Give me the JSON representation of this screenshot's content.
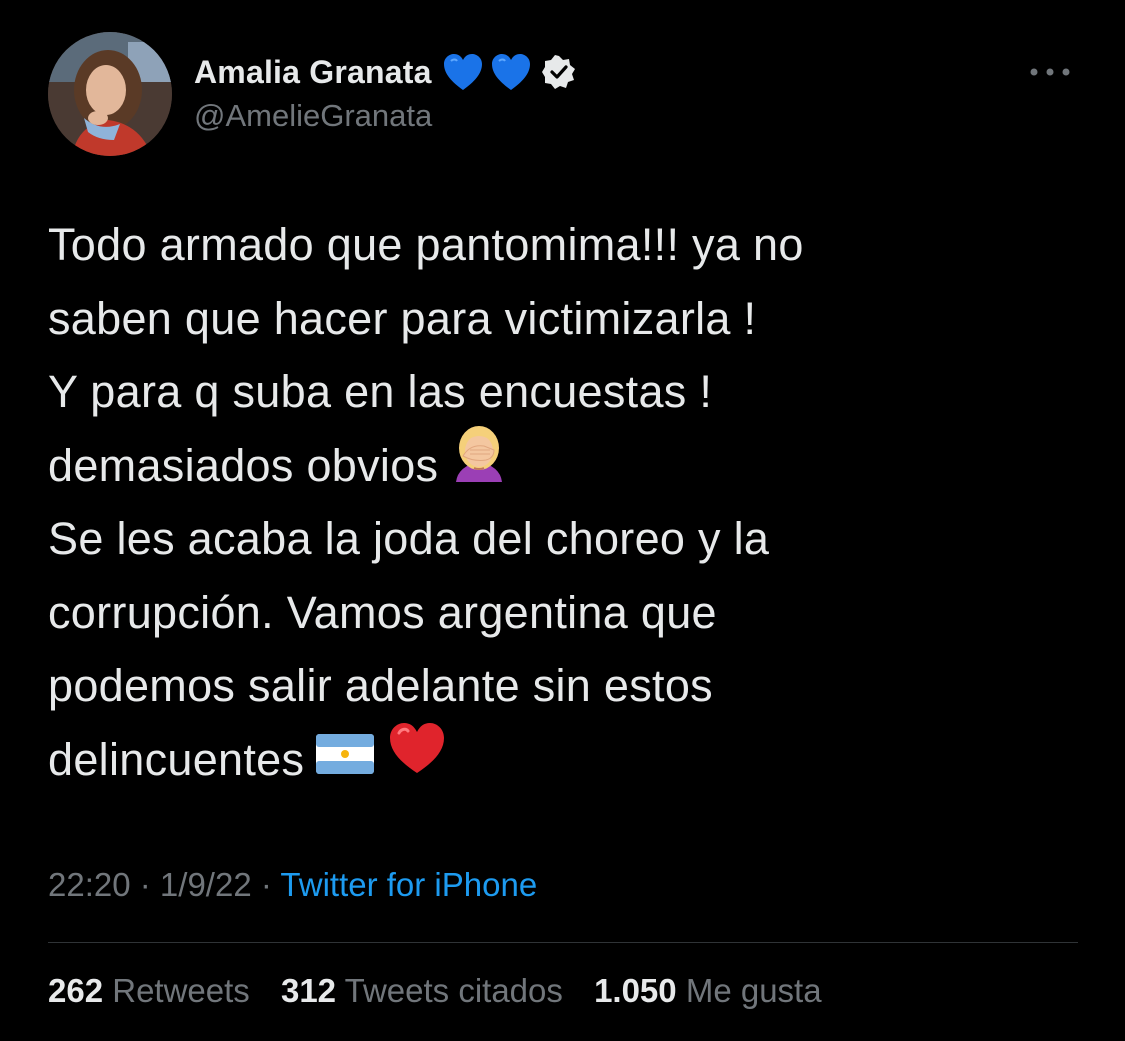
{
  "author": {
    "display_name": "Amalia Granata",
    "handle": "@AmelieGranata",
    "name_emoji": [
      "blue-heart-icon",
      "blue-heart-icon"
    ],
    "verified": true
  },
  "tweet": {
    "lines": [
      "Todo armado que pantomima!!! ya no",
      "saben que hacer para victimizarla !",
      "Y para q suba en las encuestas !",
      "demasiados obvios",
      "Se les acaba la joda del choreo y la",
      "corrupción. Vamos argentina que",
      "podemos salir adelante sin estos",
      "delincuentes"
    ],
    "emoji": {
      "line4": "face-palm-icon",
      "line8": [
        "argentina-flag-icon",
        "red-heart-icon"
      ]
    }
  },
  "meta": {
    "time": "22:20",
    "separator": " · ",
    "date": "1/9/22",
    "source": "Twitter for iPhone"
  },
  "stats": {
    "retweets_count": "262",
    "retweets_label": "Retweets",
    "quotes_count": "312",
    "quotes_label": "Tweets citados",
    "likes_count": "1.050",
    "likes_label": "Me gusta"
  },
  "colors": {
    "background": "#000000",
    "text": "#e7e9ea",
    "secondary": "#71767b",
    "link": "#1d9bf0",
    "divider": "#2f3336"
  }
}
